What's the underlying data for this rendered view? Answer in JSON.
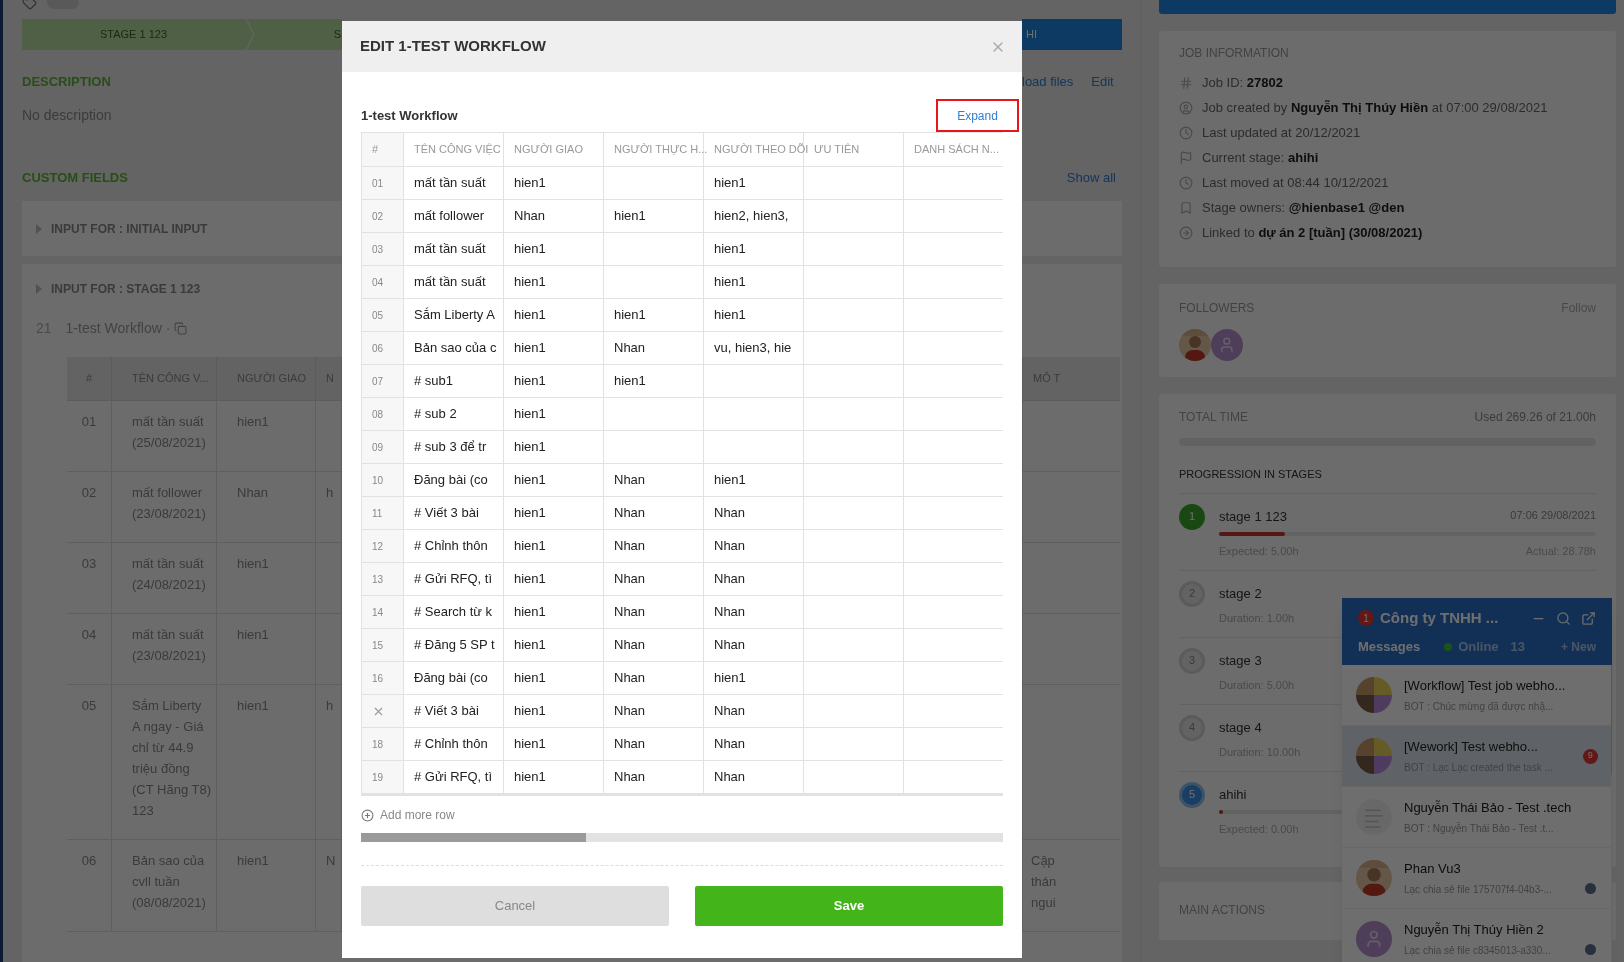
{
  "background": {
    "stages": [
      {
        "label": "STAGE 1 123",
        "kind": "done"
      },
      {
        "label": "S",
        "kind": "done"
      },
      {
        "label": "HI",
        "kind": "current"
      }
    ],
    "description": {
      "title": "DESCRIPTION",
      "text": "No description",
      "actions": [
        "load files",
        "Edit"
      ]
    },
    "custom_fields": {
      "title": "CUSTOM FIELDS",
      "show_all": "Show all",
      "sections": [
        "INPUT FOR : INITIAL INPUT",
        "INPUT FOR : STAGE 1 123"
      ]
    },
    "workflow": {
      "count": "21",
      "title": "1-test Workflow ·",
      "columns": [
        "#",
        "TÊN CÔNG V...",
        "NGƯỜI GIAO",
        "N"
      ],
      "right_column": "MÔ T",
      "rows": [
        {
          "num": "01",
          "name": "mất tần suất (25/08/2021)",
          "giver": "hien1"
        },
        {
          "num": "02",
          "name": "mất follower (23/08/2021)",
          "giver": "Nhan",
          "col4": "h"
        },
        {
          "num": "03",
          "name": "mất tần suất (24/08/2021)",
          "giver": "hien1"
        },
        {
          "num": "04",
          "name": "mất tần suất (23/08/2021)",
          "giver": "hien1"
        },
        {
          "num": "05",
          "name": "Sắm Liberty A ngay - Giá chỉ từ 44.9 triệu đồng (CT Hãng T8) 123",
          "giver": "hien1",
          "col4": "h"
        },
        {
          "num": "06",
          "name": "Bản sao của cvll tuần (08/08/2021)",
          "giver": "hien1",
          "col4": "N",
          "right": "Cập thán ngui"
        }
      ]
    }
  },
  "sidebar": {
    "job_info": {
      "title": "JOB INFORMATION",
      "lines": [
        "Job ID: **27802**",
        "Job created by **Nguyễn Thị Thúy Hiền** at 07:00 29/08/2021",
        "Last updated at 20/12/2021",
        "Current stage: **ahihi**",
        "Last moved at 08:44 10/12/2021",
        "Stage owners: **@hienbase1 @den**",
        "Linked to **dự án 2 [tuần] (30/08/2021)**"
      ]
    },
    "followers": {
      "title": "FOLLOWERS",
      "action": "Follow",
      "avatars": [
        {
          "kind": "photo"
        },
        {
          "kind": "placeholder"
        }
      ]
    },
    "total_time": {
      "title": "TOTAL TIME",
      "used": "Used 269.26 of 21.00h",
      "subtitle": "PROGRESSION IN STAGES",
      "stages": [
        {
          "number": "1",
          "name": "stage 1 123",
          "kind": "done",
          "date": "07:06 29/08/2021",
          "level": 0.175,
          "left": "Expected: 5.00h",
          "right": "Actual: 28.78h"
        },
        {
          "number": "2",
          "name": "stage 2",
          "kind": "pending",
          "left": "Duration: 1.00h"
        },
        {
          "number": "3",
          "name": "stage 3",
          "kind": "pending",
          "left": "Duration: 5.00h"
        },
        {
          "number": "4",
          "name": "stage 4",
          "kind": "pending",
          "left": "Duration: 10.00h"
        },
        {
          "number": "5",
          "name": "ahihi",
          "kind": "current",
          "level": 0.01,
          "left": "Expected: 0.00h"
        }
      ]
    },
    "main_actions": {
      "title": "MAIN ACTIONS"
    }
  },
  "chat": {
    "unread": "1",
    "title": "Công ty TNHH ...",
    "tabs": [
      {
        "label": "Messages",
        "selected": true
      },
      {
        "label": "Online",
        "count": "13",
        "selected": false
      }
    ],
    "new": "+ New",
    "conversations": [
      {
        "title": "[Workflow] Test job webho...",
        "preview": "BOT : Chúc mừng đã được nhậ...",
        "kind": "group",
        "selected": false,
        "seen": false
      },
      {
        "title": "[Wework] Test webho...",
        "preview": "BOT : Lạc Lạc created the task ...",
        "kind": "group",
        "badge": "9",
        "selected": true,
        "seen": false
      },
      {
        "title": "Nguyễn Thái Bảo - Test .tech",
        "preview": "BOT : Nguyễn Thái Bảo - Test .t...",
        "kind": "document",
        "selected": false,
        "seen": false
      },
      {
        "title": "Phan Vu3",
        "preview": "Lạc chia sẻ file 175707f4-04b3-...",
        "kind": "photo",
        "selected": false,
        "seen": true
      },
      {
        "title": "Nguyễn Thị Thúy Hiền 2",
        "preview": "Lạc chia sẻ file c8345013-a330...",
        "kind": "placeholder",
        "selected": false,
        "seen": true
      }
    ]
  },
  "modal": {
    "title": "EDIT 1-TEST WORKFLOW",
    "subtitle": "1-test Workflow",
    "expand": "Expand",
    "expand_highlighted": true,
    "columns": [
      "#",
      "TÊN CÔNG VIỆC",
      "NGƯỜI GIAO",
      "NGƯỜI THỰC H...",
      "NGƯỜI THEO DÕI",
      "ƯU TIÊN",
      "DANH SÁCH N..."
    ],
    "rows": [
      {
        "num": "01",
        "hovered": false,
        "task": "mất tần suất",
        "giver": "hien1",
        "watcher": "hien1"
      },
      {
        "num": "02",
        "hovered": false,
        "task": "mất follower",
        "giver": "Nhan",
        "doer": "hien1",
        "watcher": "hien2, hien3,"
      },
      {
        "num": "03",
        "hovered": false,
        "task": "mất tần suất",
        "giver": "hien1",
        "watcher": "hien1"
      },
      {
        "num": "04",
        "hovered": false,
        "task": "mất tần suất",
        "giver": "hien1",
        "watcher": "hien1"
      },
      {
        "num": "05",
        "hovered": false,
        "task": "Sắm Liberty A",
        "giver": "hien1",
        "doer": "hien1",
        "watcher": "hien1"
      },
      {
        "num": "06",
        "hovered": false,
        "task": "Bản sao của c",
        "giver": "hien1",
        "doer": "Nhan",
        "watcher": "vu, hien3, hie"
      },
      {
        "num": "07",
        "hovered": false,
        "task": "# sub1",
        "giver": "hien1",
        "doer": "hien1"
      },
      {
        "num": "08",
        "hovered": false,
        "task": "# sub 2",
        "giver": "hien1"
      },
      {
        "num": "09",
        "hovered": false,
        "task": "# sub 3 để tr",
        "giver": "hien1"
      },
      {
        "num": "10",
        "hovered": false,
        "task": "Đăng bài (co",
        "giver": "hien1",
        "doer": "Nhan",
        "watcher": "hien1"
      },
      {
        "num": "11",
        "hovered": false,
        "task": "# Viết 3 bài",
        "giver": "hien1",
        "doer": "Nhan",
        "watcher": "Nhan"
      },
      {
        "num": "12",
        "hovered": false,
        "task": "# Chỉnh thôn",
        "giver": "hien1",
        "doer": "Nhan",
        "watcher": "Nhan"
      },
      {
        "num": "13",
        "hovered": false,
        "task": "# Gửi RFQ, tì",
        "giver": "hien1",
        "doer": "Nhan",
        "watcher": "Nhan"
      },
      {
        "num": "14",
        "hovered": false,
        "task": "# Search từ k",
        "giver": "hien1",
        "doer": "Nhan",
        "watcher": "Nhan"
      },
      {
        "num": "15",
        "hovered": false,
        "task": "# Đăng 5 SP t",
        "giver": "hien1",
        "doer": "Nhan",
        "watcher": "Nhan"
      },
      {
        "num": "16",
        "hovered": false,
        "task": "Đăng bài (co",
        "giver": "hien1",
        "doer": "Nhan",
        "watcher": "hien1"
      },
      {
        "hovered": true,
        "task": "# Viết 3 bài",
        "giver": "hien1",
        "doer": "Nhan",
        "watcher": "Nhan"
      },
      {
        "num": "18",
        "hovered": false,
        "task": "# Chỉnh thôn",
        "giver": "hien1",
        "doer": "Nhan",
        "watcher": "Nhan"
      },
      {
        "num": "19",
        "hovered": false,
        "task": "# Gửi RFQ, tì",
        "giver": "hien1",
        "doer": "Nhan",
        "watcher": "Nhan"
      }
    ],
    "add_row": "Add more row",
    "buttons": [
      {
        "label": "Cancel",
        "kind": "secondary"
      },
      {
        "label": "Save",
        "kind": "primary"
      }
    ]
  }
}
